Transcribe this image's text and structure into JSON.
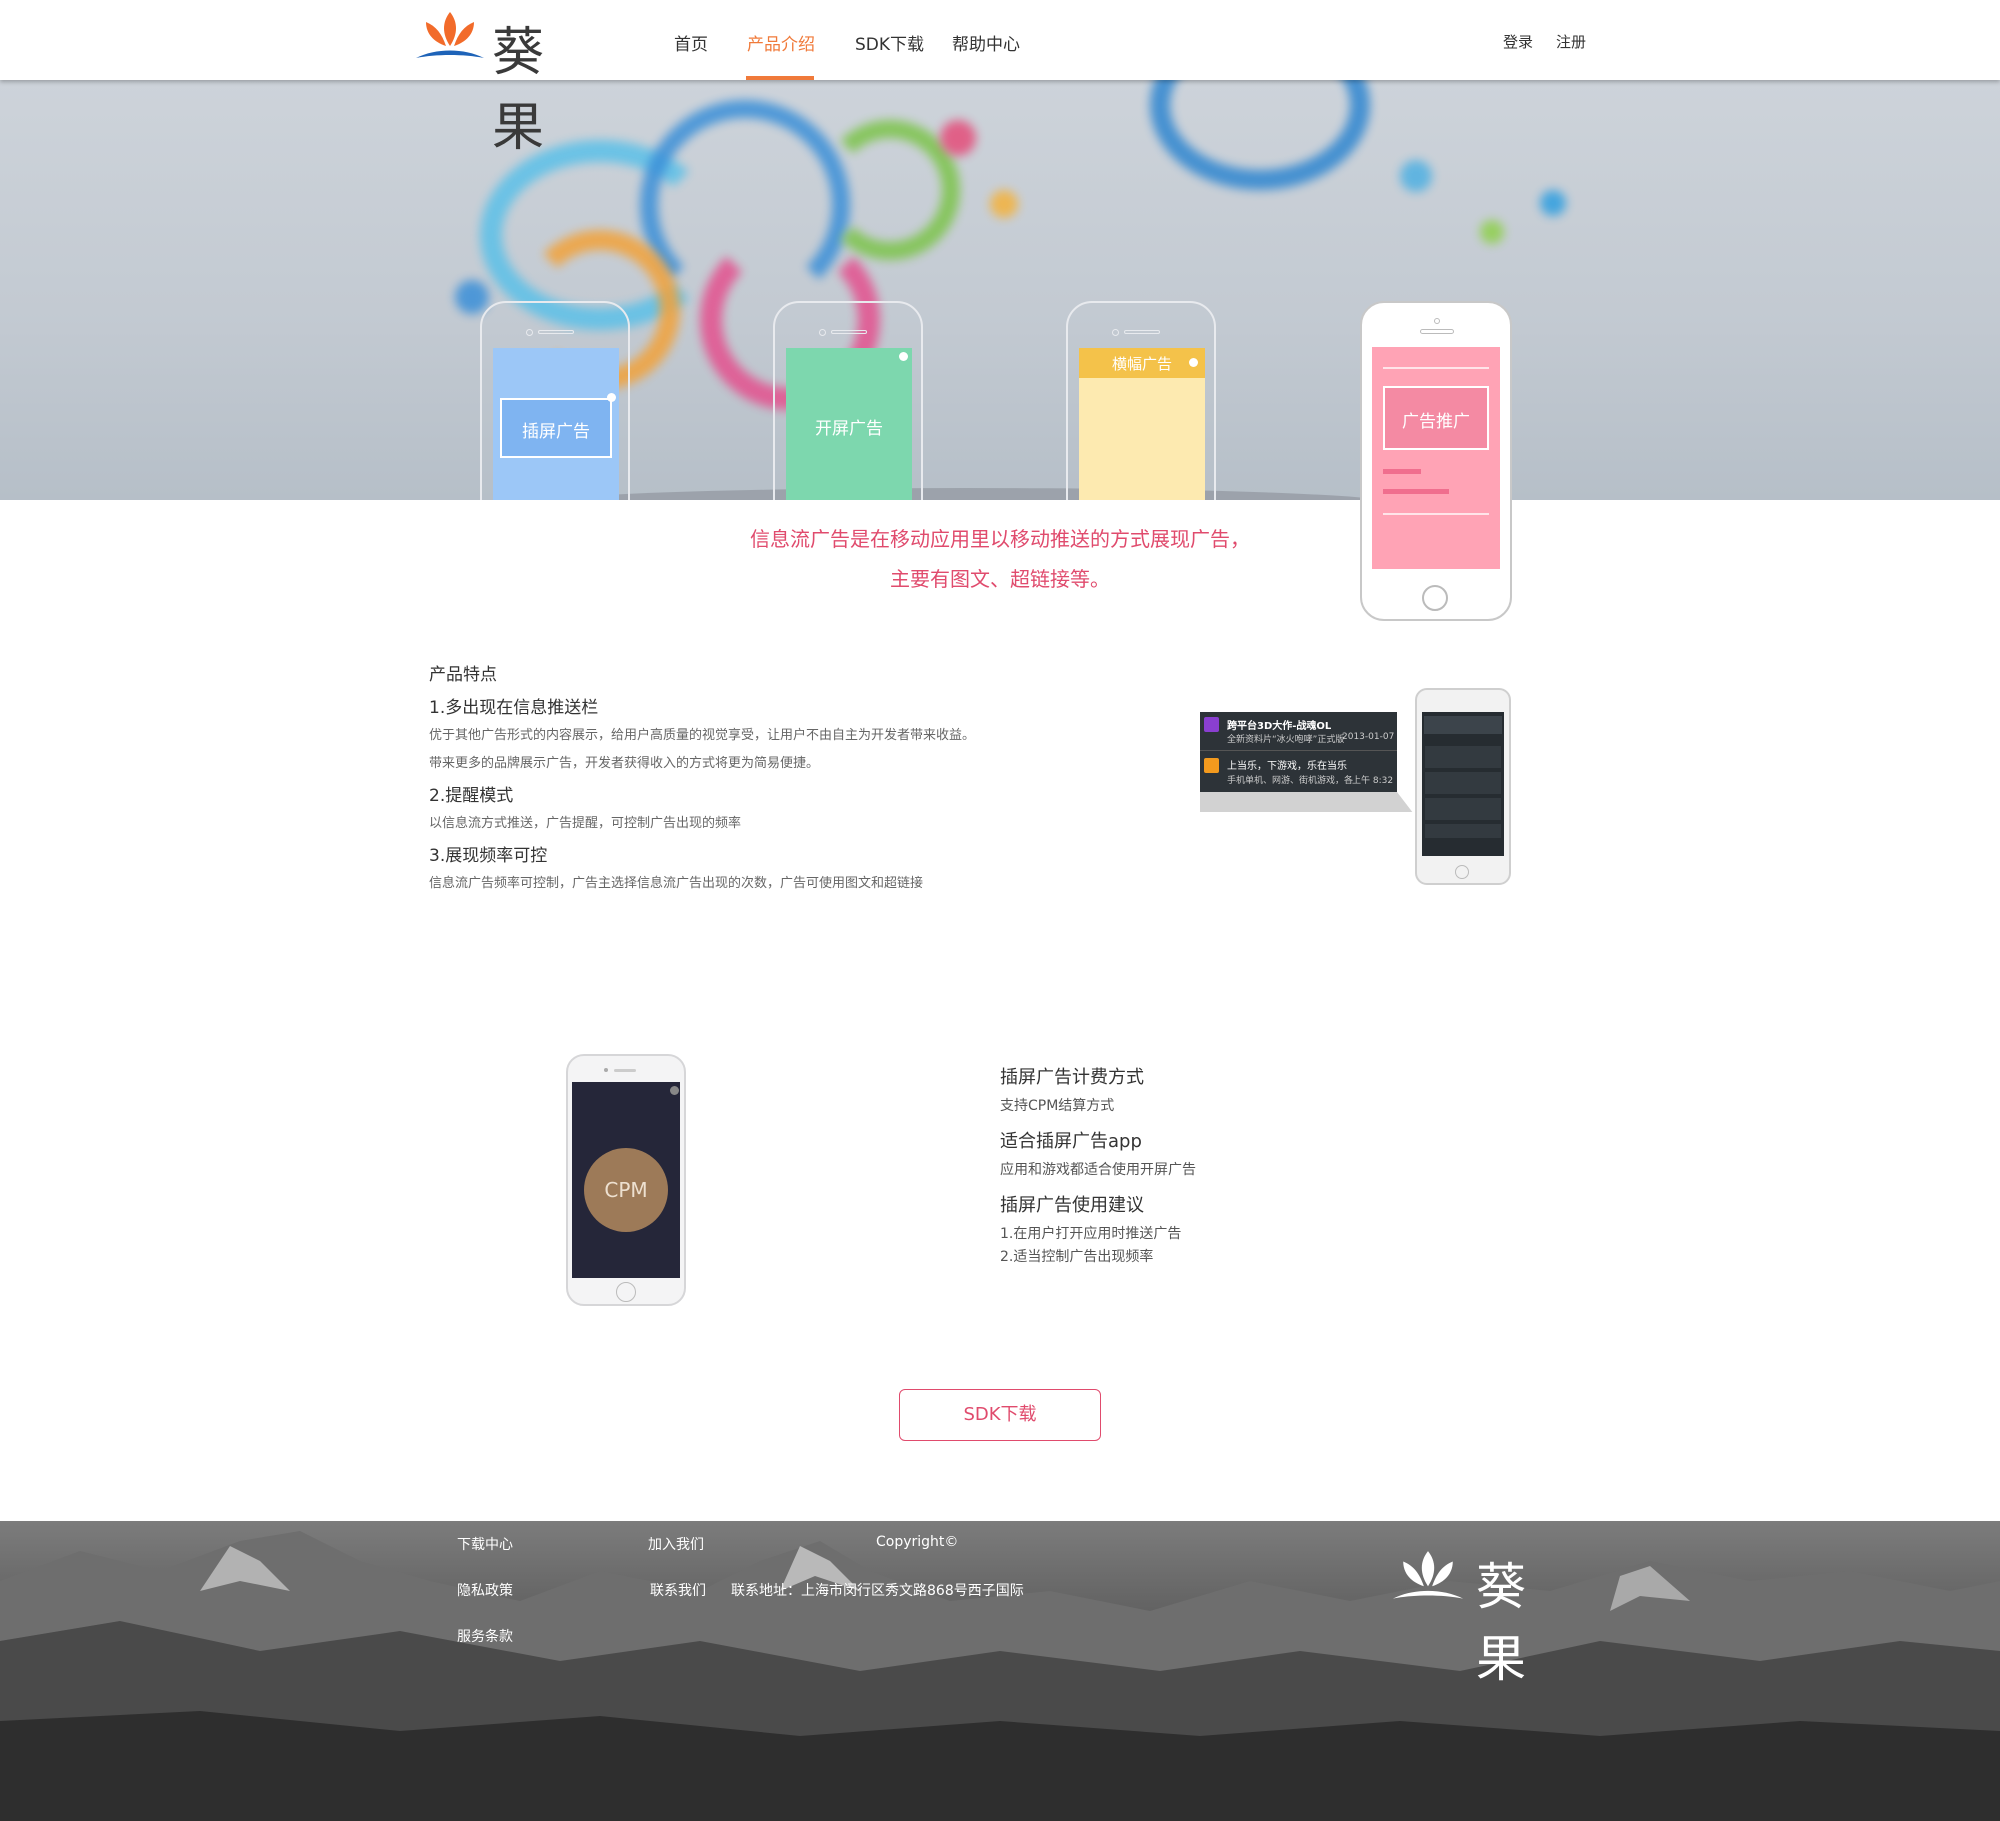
{
  "header": {
    "logo_text": "葵果",
    "nav": [
      "首页",
      "产品介绍",
      "SDK下载",
      "帮助中心"
    ],
    "active_nav": "产品介绍",
    "login": "登录",
    "register": "注册",
    "accent_color": "#f07a3a"
  },
  "banner": {
    "phones": [
      {
        "label": "插屏广告",
        "color": "#9cc7f7"
      },
      {
        "label": "开屏广告",
        "color": "#7dd7ae"
      },
      {
        "label": "横幅广告",
        "color": "#fdeab0"
      },
      {
        "label": "广告推广",
        "color": "#ffa3b5"
      }
    ]
  },
  "intro": {
    "line1": "信息流广告是在移动应用里以移动推送的方式展现广告，",
    "line2": "主要有图文、超链接等。",
    "color": "#e04b6d"
  },
  "features": {
    "heading": "产品特点",
    "items": [
      {
        "title": "1.多出现在信息推送栏",
        "lines": [
          "优于其他广告形式的内容展示，给用户高质量的视觉享受，让用户不由自主为开发者带来收益。",
          "带来更多的品牌展示广告，开发者获得收入的方式将更为简易便捷。"
        ]
      },
      {
        "title": "2.提醒模式",
        "lines": [
          "以信息流方式推送，广告提醒，可控制广告出现的频率"
        ]
      },
      {
        "title": "3.展现频率可控",
        "lines": [
          "信息流广告频率可控制，广告主选择信息流广告出现的次数，广告可使用图文和超链接"
        ]
      }
    ],
    "notification": {
      "row1_title": "跨平台3D大作-战魂OL",
      "row1_sub": "全新资料片“冰火咆哮”正式版",
      "row1_date": "2013-01-07",
      "row2_title": "上当乐，下游戏，乐在当乐",
      "row2_sub": "手机单机、网游、街机游戏，各",
      "row2_time": "上午 8:32"
    }
  },
  "billing": {
    "cpm_label": "CPM",
    "sections": [
      {
        "title": "插屏广告计费方式",
        "lines": [
          "支持CPM结算方式"
        ]
      },
      {
        "title": "适合插屏广告app",
        "lines": [
          "应用和游戏都适合使用开屏广告"
        ]
      },
      {
        "title": "插屏广告使用建议",
        "lines": [
          " 1.在用户打开应用时推送广告",
          " 2.适当控制广告出现频率"
        ]
      }
    ],
    "sdk_button": "SDK下载"
  },
  "footer": {
    "links_col1": [
      "下载中心",
      "隐私政策",
      "服务条款"
    ],
    "links_col2": [
      "加入我们",
      "联系我们"
    ],
    "copyright": "Copyright©",
    "address": "联系地址：上海市闵行区秀文路868号西子国际",
    "logo_text": "葵果"
  }
}
